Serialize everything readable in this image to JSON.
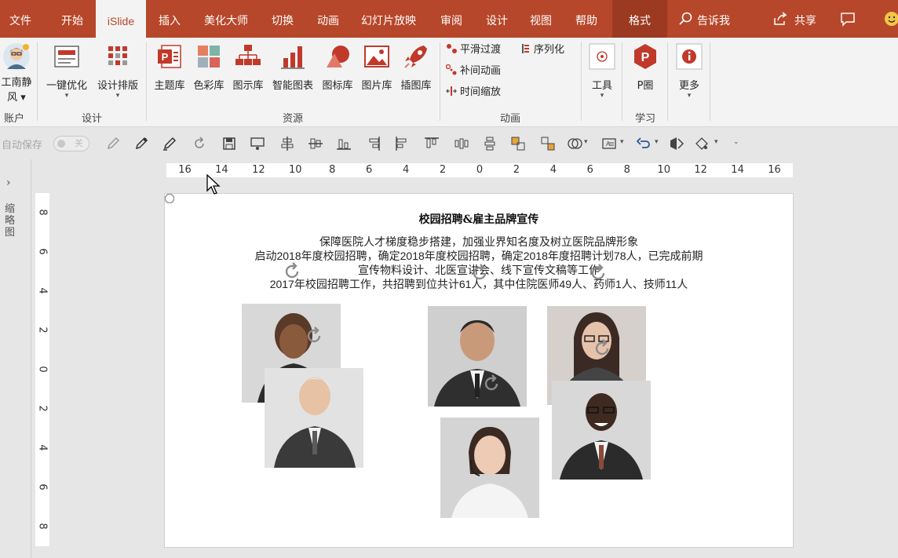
{
  "tabs": [
    {
      "label": "文件"
    },
    {
      "label": "开始"
    },
    {
      "label": "iSlide"
    },
    {
      "label": "插入"
    },
    {
      "label": "美化大师"
    },
    {
      "label": "切换"
    },
    {
      "label": "动画"
    },
    {
      "label": "幻灯片放映"
    },
    {
      "label": "审阅"
    },
    {
      "label": "设计"
    },
    {
      "label": "视图"
    },
    {
      "label": "帮助"
    },
    {
      "label": "格式"
    }
  ],
  "tell_me": "告诉我",
  "share": "共享",
  "ribbon": {
    "account": {
      "name": "工南静风",
      "name_line1": "工南静",
      "name_line2": "风",
      "group": "账户"
    },
    "design": {
      "group": "设计",
      "btn1": "一键优化",
      "btn2": "设计排版"
    },
    "resources": {
      "group": "资源",
      "items": [
        "主题库",
        "色彩库",
        "图示库",
        "智能图表",
        "图标库",
        "图片库",
        "插图库"
      ]
    },
    "animation": {
      "group": "动画",
      "smooth": "平滑过渡",
      "serialize": "序列化",
      "tween": "补间动画",
      "timescale": "时间缩放"
    },
    "tools": {
      "label": "工具"
    },
    "learn": {
      "group": "学习",
      "label": "P圈"
    },
    "more": {
      "label": "更多"
    }
  },
  "qat": {
    "autosave": "自动保存",
    "toggle": "关"
  },
  "left_pane": {
    "label": "缩略图"
  },
  "rulers": {
    "h_labels": [
      "16",
      "14",
      "12",
      "10",
      "8",
      "6",
      "4",
      "2",
      "0",
      "2",
      "4",
      "6",
      "8",
      "10",
      "12",
      "14",
      "16"
    ],
    "v_labels": [
      "8",
      "6",
      "4",
      "2",
      "0",
      "2",
      "4",
      "6",
      "8"
    ]
  },
  "slide": {
    "title": "校园招聘&雇主品牌宣传",
    "lines": [
      "保障医院人才梯度稳步搭建，加强业界知名度及树立医院品牌形象",
      "启动2018年度校园招聘，确定2018年度校园招聘，确定2018年度招聘计划78人，已完成前期",
      "宣传物料设计、北医宣讲会、线下宣传文稿等工作",
      "2017年校园招聘工作，共招聘到位共计61人，其中住院医师49人、药师1人、技师11人"
    ]
  },
  "colors": {
    "accent": "#b7472a",
    "ribbon_bg": "#f3f3f3"
  }
}
